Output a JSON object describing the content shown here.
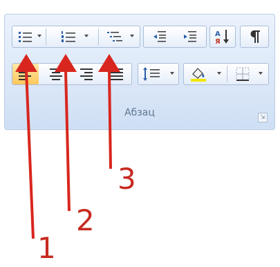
{
  "ribbon": {
    "group_label": "Абзац",
    "launcher_glyph": "⇲",
    "accent_color": "#d8261e",
    "icons": {
      "bullets": "bullets-icon",
      "numbering": "numbering-icon",
      "multilevel": "multilevel-list-icon",
      "decrease_indent": "decrease-indent-icon",
      "increase_indent": "increase-indent-icon",
      "sort": "sort-icon",
      "pilcrow": "show-formatting-marks-icon",
      "align_left": "align-left-icon",
      "align_center": "align-center-icon",
      "align_right": "align-right-icon",
      "justify": "justify-icon",
      "line_spacing": "line-spacing-icon",
      "shading": "shading-icon",
      "borders": "borders-icon"
    }
  },
  "annotations": {
    "labels": [
      "1",
      "2",
      "3"
    ]
  }
}
